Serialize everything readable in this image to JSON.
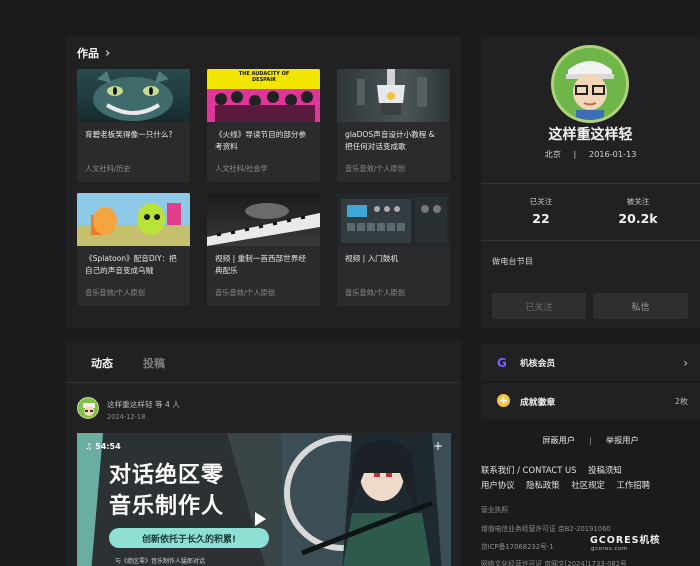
{
  "works": {
    "title": "作品",
    "cards": [
      {
        "title": "育碧老板笑得像一只什么?",
        "category": "人文社科/历史",
        "thumb": "cheshire-cat-thumbnail"
      },
      {
        "title": "《火线》导读节目的部分参考资料",
        "category": "人文社科/社会学",
        "thumb": "the-audacity-of-despair-thumbnail",
        "thumb_text": "THE AUDACITY OF DESPAIR"
      },
      {
        "title": "glaDOS声音设计小教程 & 把任何对话变成歌",
        "category": "音乐音效/个人原创",
        "thumb": "gladOS-thumbnail"
      },
      {
        "title": "《Splatoon》配音DIY：把自己的声音变成乌贼",
        "category": "音乐音效/个人原创",
        "thumb": "splatoon-thumbnail"
      },
      {
        "title": "视频 | 重制一首西部世界经典配乐",
        "category": "音乐音效/个人原创",
        "thumb": "piano-thumbnail"
      },
      {
        "title": "视频 | 入门鼓机",
        "category": "音乐音效/个人原创",
        "thumb": "drum-machine-thumbnail"
      }
    ]
  },
  "feed": {
    "tabs": [
      "动态",
      "投稿"
    ],
    "post": {
      "author_line": "这样重这样轻 等 4 人",
      "date": "2024-12-18"
    },
    "video": {
      "duration": "54:54",
      "title_line1": "对话绝区零",
      "title_line2": "音乐制作人",
      "band_text": "创新依托于长久的积累!",
      "small_text": "与《绝区零》音乐制作人猛郎对话"
    }
  },
  "profile": {
    "name": "这样重这样轻",
    "location": "北京",
    "joined": "2016-01-13",
    "separator": "|",
    "following_label": "已关注",
    "following_count": "22",
    "followers_label": "被关注",
    "followers_count": "20.2k",
    "bio": "做电台节目",
    "follow_button": "已关注",
    "message_button": "私信"
  },
  "member": {
    "label": "机核会员",
    "icon_letter": "G"
  },
  "badges": {
    "label": "成就徽章",
    "count": "2枚"
  },
  "actions": {
    "block": "屏蔽用户",
    "report": "举报用户",
    "separator": "|"
  },
  "footer": {
    "links": [
      "联系我们 / CONTACT US",
      "投稿须知",
      "用户协议",
      "隐私政策",
      "社区规定",
      "工作招聘"
    ],
    "license_title": "营业执照",
    "icp_business": "增值电信业务经营许可证 京B2-20191060",
    "icp": "京ICP备17068232号-1",
    "culture": "网络文化经营许可证 京网文[2024]1733-082号"
  },
  "brand": {
    "logo": "GCORES机核",
    "domain": "gcores.com"
  },
  "colors": {
    "background": "#1b1b1d",
    "panel": "#212123",
    "member_icon": "#7c5cff",
    "badge_icon": "#f5c542",
    "video_band": "#8fe0d4"
  }
}
